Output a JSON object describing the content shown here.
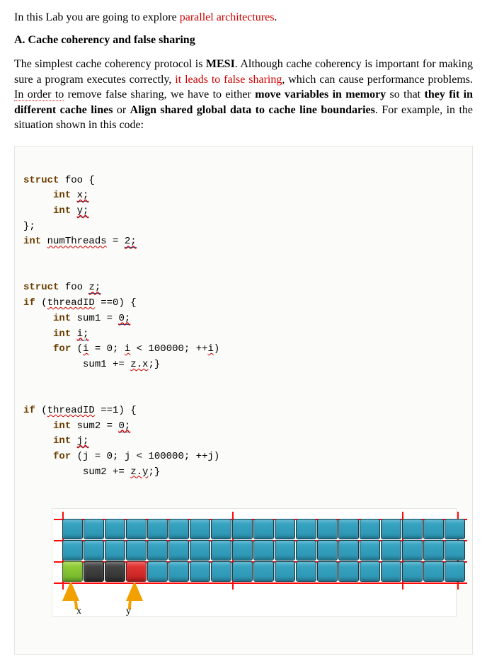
{
  "intro": {
    "prefix": "In this Lab you are going to explore ",
    "highlight": "parallel architectures",
    "suffix": "."
  },
  "section_title": "A. Cache coherency and false sharing",
  "paragraph": {
    "t1": "The simplest cache coherency protocol is ",
    "bold1": "MESI",
    "t2": ". Although cache coherency is important for making sure a program executes correctly, ",
    "red1": "it leads to false sharing",
    "t3": ", which can cause performance problems. ",
    "dotted1": "In order to",
    "t4": " remove false sharing, we have to either ",
    "bold2": "move variables in memory",
    "t5": " so that ",
    "bold3": "they fit in different cache lines",
    "t6": " or ",
    "bold4": "Align shared global data to cache line boundaries",
    "t7": ". For example, in the situation shown in this code:"
  },
  "code": {
    "l01_kw": "struct",
    "l01_rest": " foo {",
    "l02_kw": "int",
    "l02_id": "x;",
    "l03_kw": "int",
    "l03_id": "y;",
    "l04": "};",
    "l05_kw": "int",
    "l05_id": "numThreads",
    "l05_eq": " = ",
    "l05_val": "2;",
    "l06_kw": "struct",
    "l06_rest": " foo ",
    "l06_id": "z;",
    "l07_kw": "if",
    "l07_a": " (",
    "l07_id": "threadID",
    "l07_b": " ==0) {",
    "l08_kw": "int",
    "l08_a": " sum1 = ",
    "l08_val": "0;",
    "l09_kw": "int",
    "l09_id": "i;",
    "l10_kw": "for",
    "l10_a": " (",
    "l10_id1": "i",
    "l10_b": " = 0; ",
    "l10_id2": "i",
    "l10_c": " < 100000; ++",
    "l10_id3": "i",
    "l10_d": ")",
    "l11_a": "sum1 += ",
    "l11_id": "z.x",
    "l11_b": ";}",
    "l12_kw": "if",
    "l12_a": " (",
    "l12_id": "threadID",
    "l12_b": " ==1) {",
    "l13_kw": "int",
    "l13_a": " sum2 = ",
    "l13_val": "0;",
    "l14_kw": "int",
    "l14_id": "j;",
    "l15_kw": "for",
    "l15_a": " (j = 0; j < 100000; ++j)",
    "l16_a": "sum2 += ",
    "l16_id": "z.y",
    "l16_b": ";}"
  },
  "diagram": {
    "label_x": "x",
    "label_y": "y"
  }
}
